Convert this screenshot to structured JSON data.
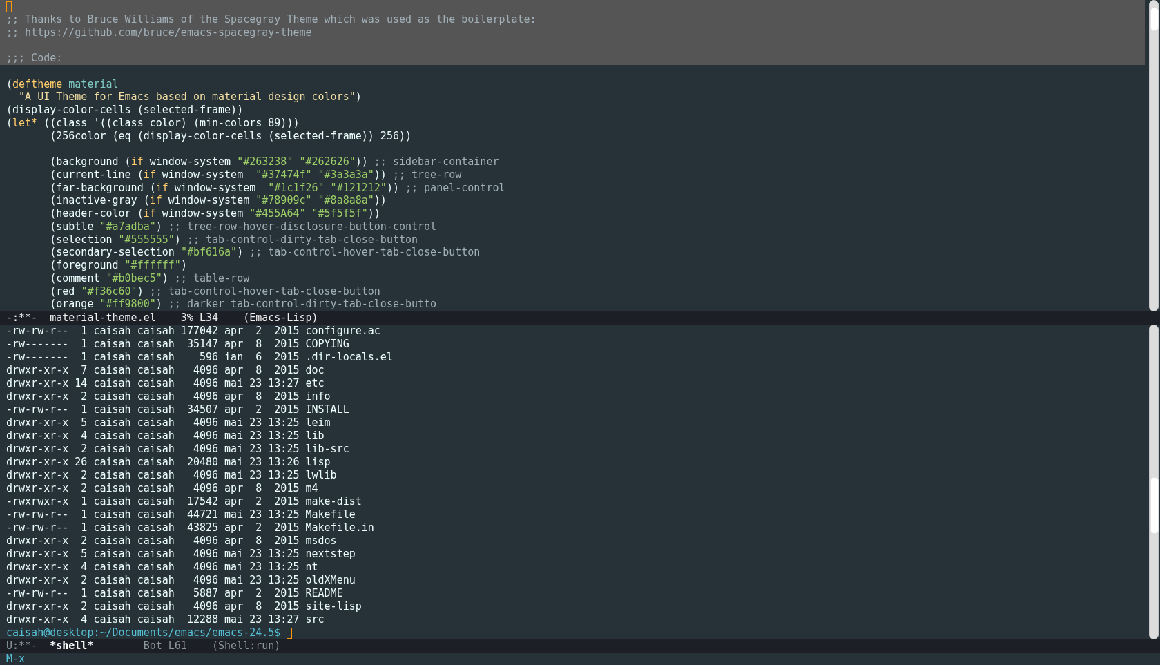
{
  "editor": {
    "lines": [
      {
        "highlighted": true,
        "cursor": true
      },
      {
        "highlighted": true,
        "segments": [
          {
            "kind": "comment",
            "text": ";; Thanks to Bruce Williams of the Spacegray Theme which was used as the boilerplate:"
          }
        ]
      },
      {
        "highlighted": true,
        "segments": [
          {
            "kind": "comment",
            "text": ";; https://github.com/bruce/emacs-spacegray-theme"
          }
        ]
      },
      {
        "highlighted": true
      },
      {
        "highlighted": true,
        "segments": [
          {
            "kind": "comment",
            "text": ";;; Code:"
          }
        ]
      },
      {
        "highlighted": false
      },
      {
        "highlighted": false,
        "segments": [
          {
            "kind": "plain",
            "text": "("
          },
          {
            "kind": "keyword",
            "text": "deftheme"
          },
          {
            "kind": "name",
            "text": " material"
          }
        ]
      },
      {
        "highlighted": false,
        "segments": [
          {
            "kind": "docstring",
            "text": "  \"A UI Theme for Emacs based on material design colors\""
          },
          {
            "kind": "plain",
            "text": ")"
          }
        ]
      },
      {
        "highlighted": false,
        "segments": [
          {
            "kind": "plain",
            "text": "(display-color-cells (selected-frame))"
          }
        ]
      },
      {
        "highlighted": false,
        "segments": [
          {
            "kind": "plain",
            "text": "("
          },
          {
            "kind": "keyword",
            "text": "let*"
          },
          {
            "kind": "plain",
            "text": " ((class '((class color) (min-colors 89)))"
          }
        ]
      },
      {
        "highlighted": false,
        "segments": [
          {
            "kind": "plain",
            "text": "       (256color (eq (display-color-cells (selected-frame)) 256))"
          }
        ]
      },
      {
        "highlighted": false
      },
      {
        "highlighted": false,
        "segments": [
          {
            "kind": "plain",
            "text": "       (background ("
          },
          {
            "kind": "keyword",
            "text": "if"
          },
          {
            "kind": "plain",
            "text": " window-system "
          },
          {
            "kind": "string",
            "text": "\"#263238\""
          },
          {
            "kind": "string",
            "text": " \"#262626\""
          },
          {
            "kind": "plain",
            "text": ")) "
          },
          {
            "kind": "comment",
            "text": ";; sidebar-container"
          }
        ]
      },
      {
        "highlighted": false,
        "segments": [
          {
            "kind": "plain",
            "text": "       (current-line ("
          },
          {
            "kind": "keyword",
            "text": "if"
          },
          {
            "kind": "plain",
            "text": " window-system  "
          },
          {
            "kind": "string",
            "text": "\"#37474f\""
          },
          {
            "kind": "string",
            "text": " \"#3a3a3a\""
          },
          {
            "kind": "plain",
            "text": ")) "
          },
          {
            "kind": "comment",
            "text": ";; tree-row"
          }
        ]
      },
      {
        "highlighted": false,
        "segments": [
          {
            "kind": "plain",
            "text": "       (far-background ("
          },
          {
            "kind": "keyword",
            "text": "if"
          },
          {
            "kind": "plain",
            "text": " window-system  "
          },
          {
            "kind": "string",
            "text": "\"#1c1f26\""
          },
          {
            "kind": "string",
            "text": " \"#121212\""
          },
          {
            "kind": "plain",
            "text": ")) "
          },
          {
            "kind": "comment",
            "text": ";; panel-control"
          }
        ]
      },
      {
        "highlighted": false,
        "segments": [
          {
            "kind": "plain",
            "text": "       (inactive-gray ("
          },
          {
            "kind": "keyword",
            "text": "if"
          },
          {
            "kind": "plain",
            "text": " window-system "
          },
          {
            "kind": "string",
            "text": "\"#78909c\""
          },
          {
            "kind": "string",
            "text": " \"#8a8a8a\""
          },
          {
            "kind": "plain",
            "text": "))"
          }
        ]
      },
      {
        "highlighted": false,
        "segments": [
          {
            "kind": "plain",
            "text": "       (header-color ("
          },
          {
            "kind": "keyword",
            "text": "if"
          },
          {
            "kind": "plain",
            "text": " window-system "
          },
          {
            "kind": "string",
            "text": "\"#455A64\""
          },
          {
            "kind": "string",
            "text": " \"#5f5f5f\""
          },
          {
            "kind": "plain",
            "text": "))"
          }
        ]
      },
      {
        "highlighted": false,
        "segments": [
          {
            "kind": "plain",
            "text": "       (subtle "
          },
          {
            "kind": "string",
            "text": "\"#a7adba\""
          },
          {
            "kind": "plain",
            "text": ") "
          },
          {
            "kind": "comment",
            "text": ";; tree-row-hover-disclosure-button-control"
          }
        ]
      },
      {
        "highlighted": false,
        "segments": [
          {
            "kind": "plain",
            "text": "       (selection "
          },
          {
            "kind": "string",
            "text": "\"#555555\""
          },
          {
            "kind": "plain",
            "text": ") "
          },
          {
            "kind": "comment",
            "text": ";; tab-control-dirty-tab-close-button"
          }
        ]
      },
      {
        "highlighted": false,
        "segments": [
          {
            "kind": "plain",
            "text": "       (secondary-selection "
          },
          {
            "kind": "string",
            "text": "\"#bf616a\""
          },
          {
            "kind": "plain",
            "text": ") "
          },
          {
            "kind": "comment",
            "text": ";; tab-control-hover-tab-close-button"
          }
        ]
      },
      {
        "highlighted": false,
        "segments": [
          {
            "kind": "plain",
            "text": "       (foreground "
          },
          {
            "kind": "string",
            "text": "\"#ffffff\""
          },
          {
            "kind": "plain",
            "text": ")"
          }
        ]
      },
      {
        "highlighted": false,
        "segments": [
          {
            "kind": "plain",
            "text": "       (comment "
          },
          {
            "kind": "string",
            "text": "\"#b0bec5\""
          },
          {
            "kind": "plain",
            "text": ") "
          },
          {
            "kind": "comment",
            "text": ";; table-row"
          }
        ]
      },
      {
        "highlighted": false,
        "segments": [
          {
            "kind": "plain",
            "text": "       (red "
          },
          {
            "kind": "string",
            "text": "\"#f36c60\""
          },
          {
            "kind": "plain",
            "text": ") "
          },
          {
            "kind": "comment",
            "text": ";; tab-control-hover-tab-close-button"
          }
        ]
      },
      {
        "highlighted": false,
        "segments": [
          {
            "kind": "plain",
            "text": "       (orange "
          },
          {
            "kind": "string",
            "text": "\"#ff9800\""
          },
          {
            "kind": "plain",
            "text": ") "
          },
          {
            "kind": "comment",
            "text": ";; darker tab-control-dirty-tab-close-butto"
          }
        ]
      }
    ],
    "mode_line": {
      "active": false,
      "status": "-:**-",
      "buffer": "material-theme.el",
      "position": "3% L34",
      "mode": "(Emacs-Lisp)"
    }
  },
  "shell": {
    "lines": [
      "-rw-rw-r--  1 caisah caisah 177042 apr  2  2015 configure.ac",
      "-rw-------  1 caisah caisah  35147 apr  8  2015 COPYING",
      "-rw-------  1 caisah caisah    596 ian  6  2015 .dir-locals.el",
      "drwxr-xr-x  7 caisah caisah   4096 apr  8  2015 doc",
      "drwxr-xr-x 14 caisah caisah   4096 mai 23 13:27 etc",
      "drwxr-xr-x  2 caisah caisah   4096 apr  8  2015 info",
      "-rw-rw-r--  1 caisah caisah  34507 apr  2  2015 INSTALL",
      "drwxr-xr-x  5 caisah caisah   4096 mai 23 13:25 leim",
      "drwxr-xr-x  4 caisah caisah   4096 mai 23 13:25 lib",
      "drwxr-xr-x  2 caisah caisah   4096 mai 23 13:25 lib-src",
      "drwxr-xr-x 26 caisah caisah  20480 mai 23 13:26 lisp",
      "drwxr-xr-x  2 caisah caisah   4096 mai 23 13:25 lwlib",
      "drwxr-xr-x  2 caisah caisah   4096 apr  8  2015 m4",
      "-rwxrwxr-x  1 caisah caisah  17542 apr  2  2015 make-dist",
      "-rw-rw-r--  1 caisah caisah  44721 mai 23 13:25 Makefile",
      "-rw-rw-r--  1 caisah caisah  43825 apr  2  2015 Makefile.in",
      "drwxr-xr-x  2 caisah caisah   4096 apr  8  2015 msdos",
      "drwxr-xr-x  5 caisah caisah   4096 mai 23 13:25 nextstep",
      "drwxr-xr-x  4 caisah caisah   4096 mai 23 13:25 nt",
      "drwxr-xr-x  2 caisah caisah   4096 mai 23 13:25 oldXMenu",
      "-rw-rw-r--  1 caisah caisah   5887 apr  2  2015 README",
      "drwxr-xr-x  2 caisah caisah   4096 apr  8  2015 site-lisp",
      "drwxr-xr-x  4 caisah caisah  12288 mai 23 13:27 src"
    ],
    "prompt": "caisah@desktop:~/Documents/emacs/emacs-24.5$",
    "mode_line": {
      "active": true,
      "status": "U:**-",
      "buffer": "*shell*",
      "position": "Bot L61",
      "mode": "(Shell:run)"
    }
  },
  "minibuffer": "M-x"
}
